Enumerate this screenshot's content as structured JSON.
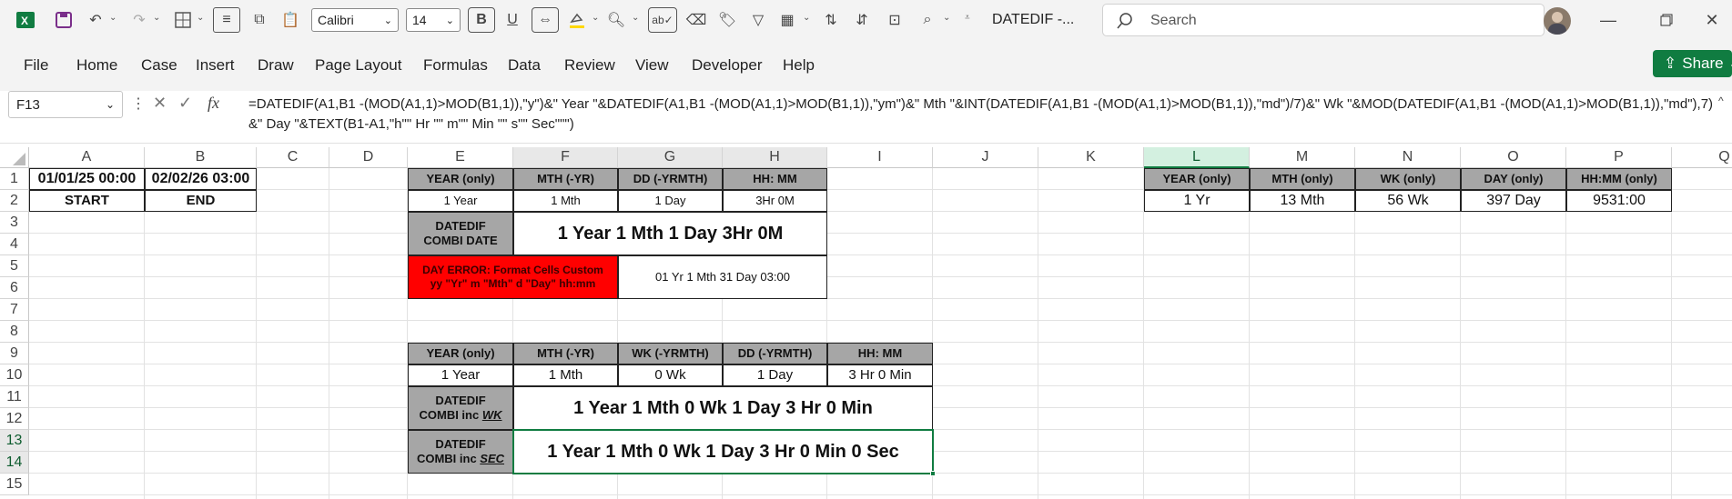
{
  "app": {
    "title": "DATEDIF  -...",
    "search_placeholder": "Search",
    "font_name": "Calibri",
    "font_size": "14"
  },
  "menu": [
    "File",
    "Home",
    "Case",
    "Insert",
    "Draw",
    "Page Layout",
    "Formulas",
    "Data",
    "Review",
    "View",
    "Developer",
    "Help"
  ],
  "share_label": "Share",
  "formula_bar": {
    "name_box": "F13",
    "fx": "fx",
    "formula": "=DATEDIF(A1,B1 -(MOD(A1,1)>MOD(B1,1)),\"y\")&\" Year \"&DATEDIF(A1,B1 -(MOD(A1,1)>MOD(B1,1)),\"ym\")&\" Mth \"&INT(DATEDIF(A1,B1 -(MOD(A1,1)>MOD(B1,1)),\"md\")/7)&\" Wk \"&MOD(DATEDIF(A1,B1 -(MOD(A1,1)>MOD(B1,1)),\"md\"),7)&\" Day \"&TEXT(B1-A1,\"h\"\" Hr \"\" m\"\" Min \"\" s\"\" Sec\"\"\")"
  },
  "columns": [
    "A",
    "B",
    "C",
    "D",
    "E",
    "F",
    "G",
    "H",
    "I",
    "J",
    "K",
    "L",
    "M",
    "N",
    "O",
    "P",
    "Q"
  ],
  "rows": [
    "1",
    "2",
    "3",
    "4",
    "5",
    "6",
    "7",
    "8",
    "9",
    "10",
    "11",
    "12",
    "13",
    "14",
    "15"
  ],
  "cells": {
    "a1": "01/01/25 00:00",
    "b1": "02/02/26 03:00",
    "a2": "START",
    "b2": "END",
    "t1_headers": [
      "YEAR (only)",
      "MTH (-YR)",
      "DD (-YRMTH)",
      "HH: MM"
    ],
    "t1_values": [
      "1 Year",
      "1 Mth",
      "1 Day",
      "3Hr 0M"
    ],
    "t1_combi_label_1": "DATEDIF",
    "t1_combi_label_2": "COMBI DATE",
    "t1_combi_value": "1 Year 1 Mth 1 Day 3Hr 0M",
    "t1_error_label_1": "DAY ERROR: Format Cells Custom",
    "t1_error_label_2": "yy \"Yr\" m \"Mth\" d \"Day\" hh:mm",
    "t1_error_value": "01 Yr 1 Mth 31 Day 03:00",
    "t2_headers": [
      "YEAR (only)",
      "MTH (-YR)",
      "WK (-YRMTH)",
      "DD (-YRMTH)",
      "HH: MM"
    ],
    "t2_values": [
      "1 Year",
      "1 Mth",
      "0 Wk",
      "1 Day",
      "3 Hr  0 Min"
    ],
    "t2_wk_label_1": "DATEDIF",
    "t2_wk_label_2a": "COMBI inc ",
    "t2_wk_label_2b": "WK",
    "t2_wk_value": "1 Year 1 Mth 0 Wk 1 Day 3 Hr  0 Min",
    "t2_sec_label_1": "DATEDIF",
    "t2_sec_label_2a": "COMBI inc ",
    "t2_sec_label_2b": "SEC",
    "t2_sec_value": "1 Year 1 Mth 0 Wk 1 Day 3 Hr  0 Min  0 Sec",
    "t3_headers": [
      "YEAR (only)",
      "MTH (only)",
      "WK (only)",
      "DAY (only)",
      "HH:MM (only)"
    ],
    "t3_values": [
      "1 Yr",
      "13 Mth",
      "56 Wk",
      "397 Day",
      "9531:00"
    ]
  },
  "colors": {
    "accent": "#107c41",
    "header_grey": "#a6a6a6",
    "error_red": "#ff0000"
  }
}
